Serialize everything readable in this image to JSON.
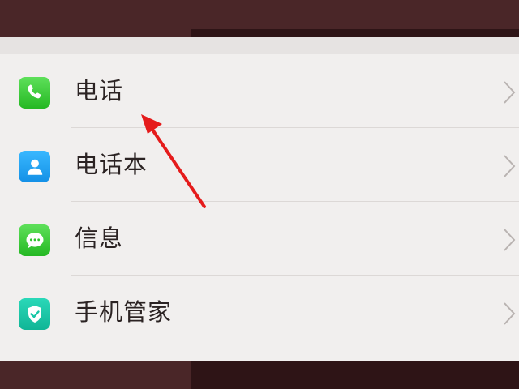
{
  "settings_list": {
    "items": [
      {
        "label": "电话",
        "icon": "phone-icon",
        "color": "#3ecf3a"
      },
      {
        "label": "电话本",
        "icon": "contacts-icon",
        "color": "#1fa4f5"
      },
      {
        "label": "信息",
        "icon": "message-icon",
        "color": "#3ecf3a"
      },
      {
        "label": "手机管家",
        "icon": "shield-icon",
        "color": "#16c6a6"
      }
    ]
  },
  "colors": {
    "background_dark": "#4a2628",
    "panel": "#f1efee",
    "annotation_arrow": "#e51b1b"
  }
}
